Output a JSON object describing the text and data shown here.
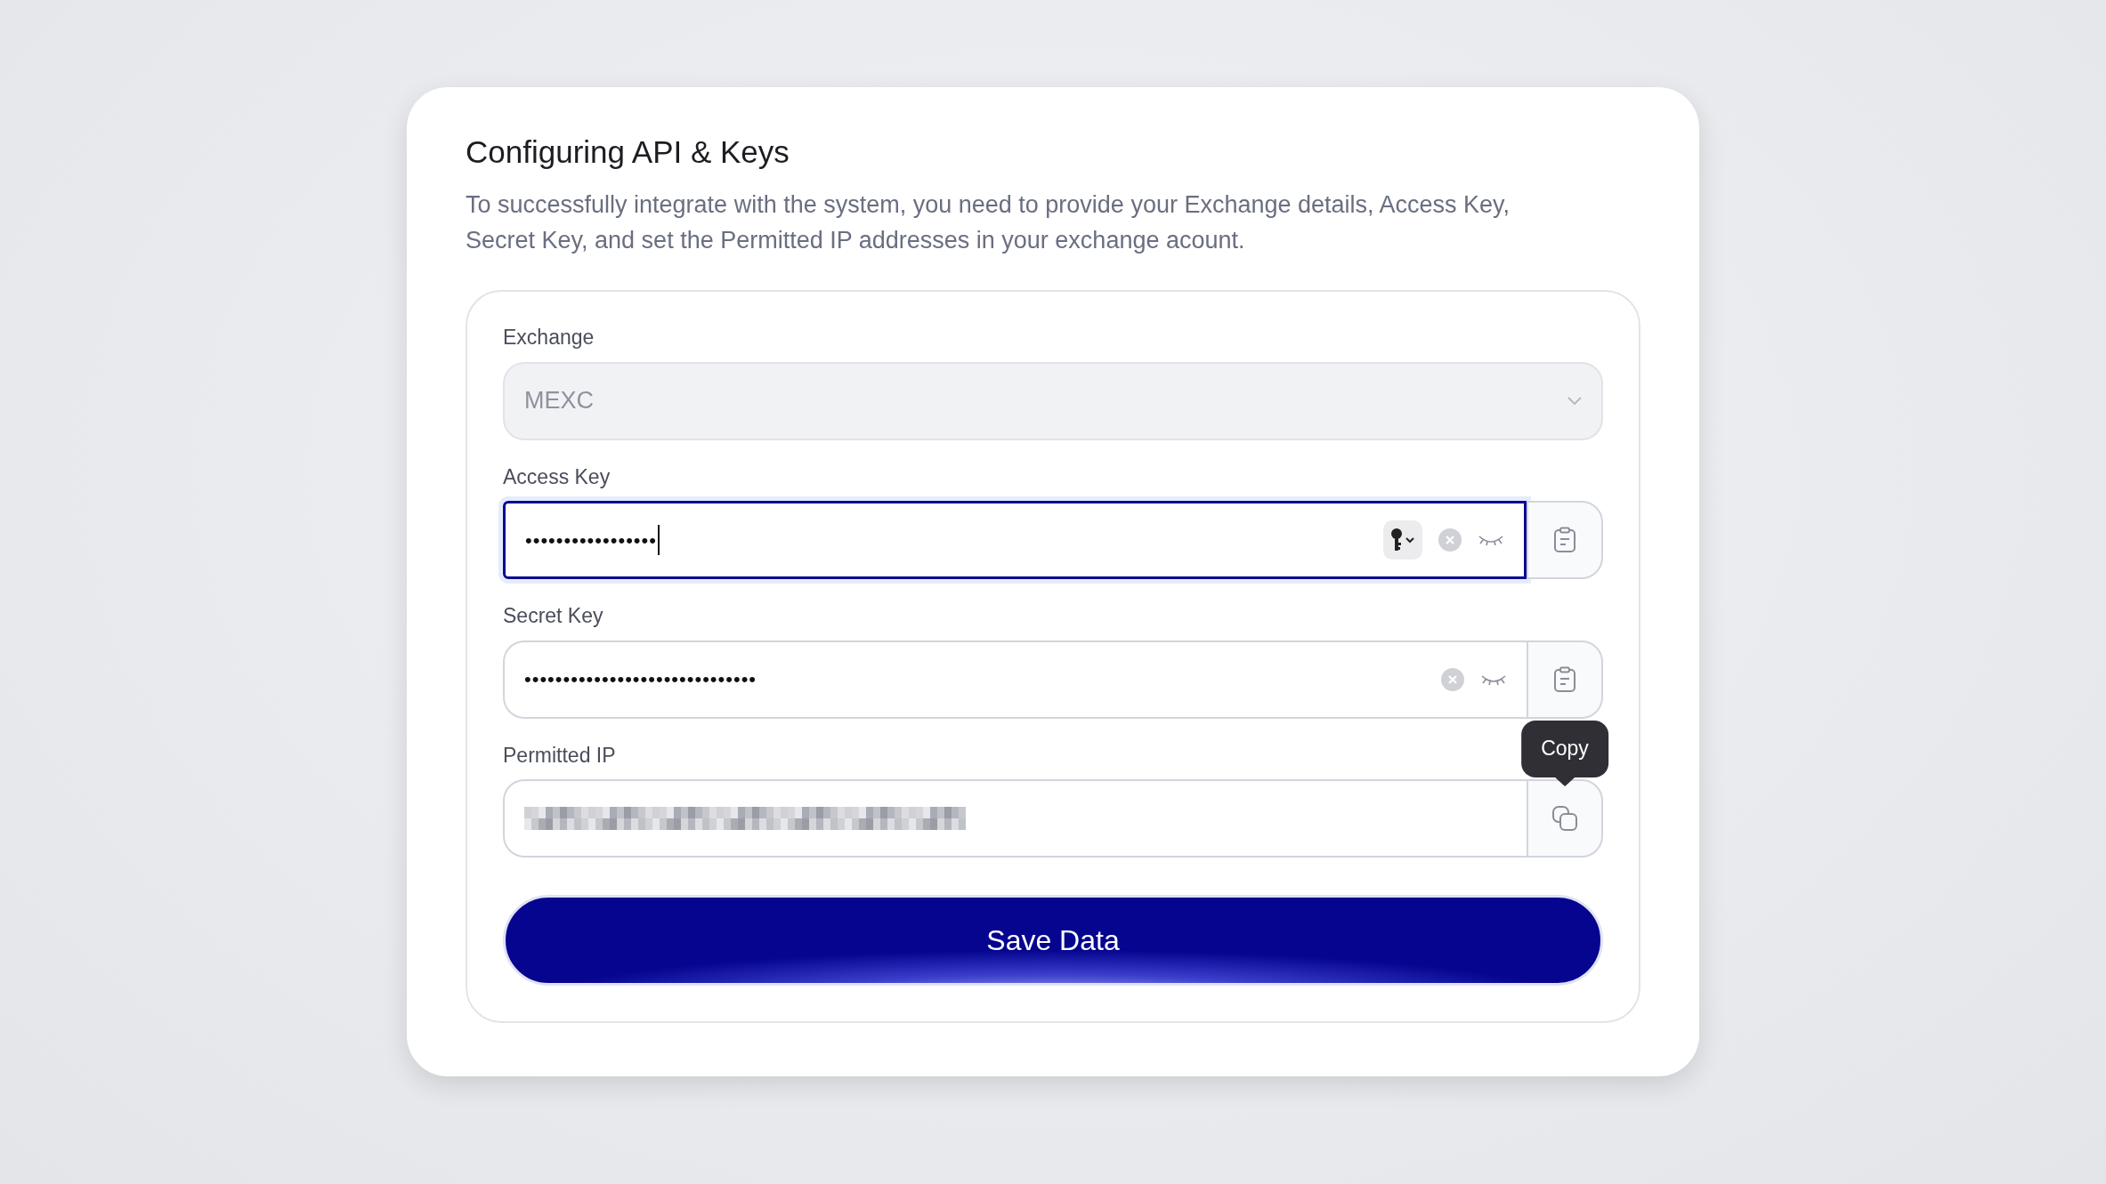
{
  "title": "Configuring API & Keys",
  "description": "To successfully integrate with the system, you need to provide your Exchange details, Access Key, Secret Key, and set the Permitted IP addresses in your exchange acount.",
  "exchange": {
    "label": "Exchange",
    "value": "MEXC",
    "disabled": true
  },
  "fields": [
    {
      "label": "Access Key",
      "kind": "secret",
      "value": "•••••••••••••••••",
      "focused": true,
      "key_menu": true,
      "side_button": {
        "kind": "paste"
      }
    },
    {
      "label": "Secret Key",
      "kind": "secret",
      "value": "••••••••••••••••••••••••••••••",
      "focused": false,
      "key_menu": false,
      "side_button": {
        "kind": "paste"
      }
    },
    {
      "label": "Permitted IP",
      "kind": "redacted",
      "side_button": {
        "kind": "copy"
      },
      "tooltip": "Copy"
    }
  ],
  "save_button": "Save Data"
}
